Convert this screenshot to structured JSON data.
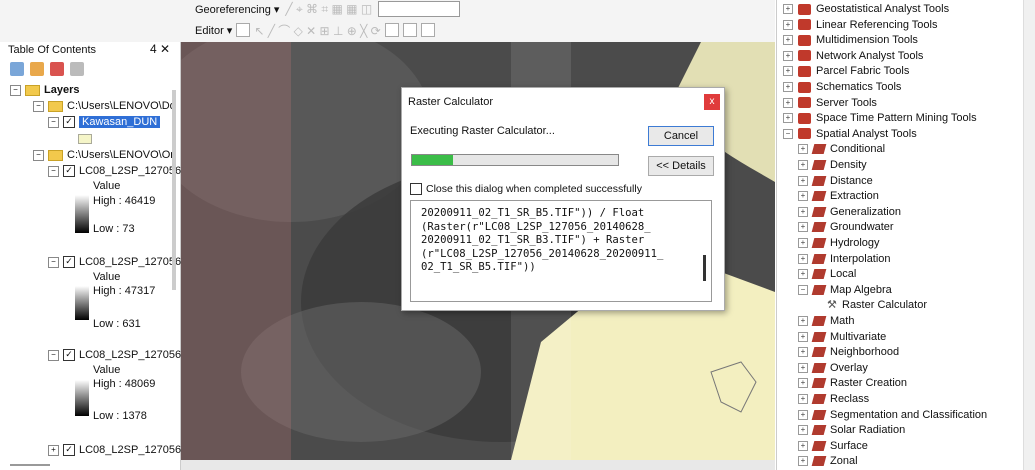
{
  "toolbars": {
    "georeferencing_label": "Georeferencing ▾",
    "editor_label": "Editor ▾"
  },
  "toc": {
    "title": "Table Of Contents",
    "controls": "4 ✕",
    "layers_label": "Layers",
    "groups": [
      {
        "path": "C:\\Users\\LENOVO\\Do"
      },
      {
        "path": "C:\\Users\\LENOVO\\On"
      }
    ],
    "selected_layer": "Kawasan_DUN",
    "raster_layers": [
      {
        "name": "LC08_L2SP_127056",
        "value_label": "Value",
        "high": "High : 46419",
        "low": "Low : 73"
      },
      {
        "name": "LC08_L2SP_127056",
        "value_label": "Value",
        "high": "High : 47317",
        "low": "Low : 631"
      },
      {
        "name": "LC08_L2SP_127056",
        "value_label": "Value",
        "high": "High : 48069",
        "low": "Low : 1378"
      },
      {
        "name": "LC08_L2SP_127056"
      }
    ]
  },
  "dialog": {
    "title": "Raster Calculator",
    "close_glyph": "x",
    "status": "Executing Raster Calculator...",
    "cancel_label": "Cancel",
    "details_label": "<< Details",
    "progress": 0.2,
    "close_when_done_label": "Close this dialog when completed successfully",
    "message_lines": [
      "20200911_02_T1_SR_B5.TIF\")) / Float",
      "(Raster(r\"LC08_L2SP_127056_20140628_",
      "20200911_02_T1_SR_B3.TIF\") + Raster",
      "(r\"LC08_L2SP_127056_20140628_20200911_",
      "02_T1_SR_B5.TIF\"))"
    ]
  },
  "toolbox": {
    "top_items": [
      "Geostatistical Analyst Tools",
      "Linear Referencing Tools",
      "Multidimension Tools",
      "Network Analyst Tools",
      "Parcel Fabric Tools",
      "Schematics Tools",
      "Server Tools",
      "Space Time Pattern Mining Tools",
      "Spatial Analyst Tools"
    ],
    "spatial_analyst_items": [
      "Conditional",
      "Density",
      "Distance",
      "Extraction",
      "Generalization",
      "Groundwater",
      "Hydrology",
      "Interpolation",
      "Local",
      "Map Algebra",
      "Raster Calculator",
      "Math",
      "Multivariate",
      "Neighborhood",
      "Overlay",
      "Raster Creation",
      "Reclass",
      "Segmentation and Classification",
      "Solar Radiation",
      "Surface",
      "Zonal"
    ]
  },
  "colors": {
    "selection": "#2f6fd6",
    "toolbox_icon": "#c0392b",
    "progress": "#3bbd48",
    "dialog_close": "#e03b3b"
  }
}
